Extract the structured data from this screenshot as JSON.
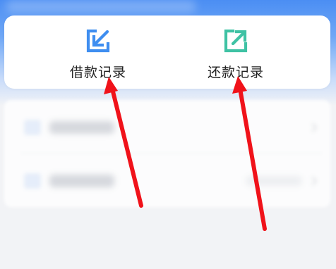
{
  "colors": {
    "header_blue": "#4b8ef3",
    "borrow_icon": "#3f8ef0",
    "repay_icon": "#3fc2a4",
    "arrow_red": "#f0121a"
  },
  "quick_actions": [
    {
      "label": "借款记录",
      "icon": "borrow-record-icon"
    },
    {
      "label": "还款记录",
      "icon": "repay-record-icon"
    }
  ],
  "annotations": {
    "arrow_count": 2,
    "arrow_color": "#f0121a"
  }
}
